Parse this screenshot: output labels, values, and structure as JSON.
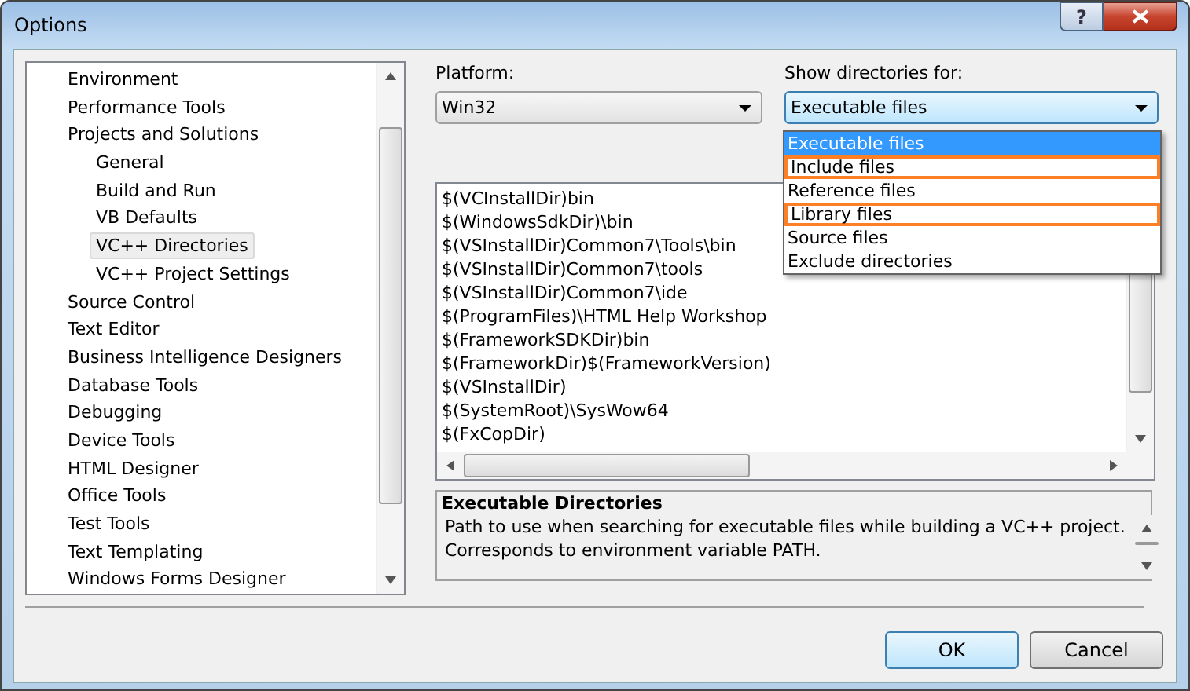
{
  "window": {
    "title": "Options",
    "help_button": "?"
  },
  "tree": {
    "items": [
      {
        "label": "Environment",
        "selected": false
      },
      {
        "label": "Performance Tools",
        "selected": false
      },
      {
        "label": "Projects and Solutions",
        "selected": false,
        "children": [
          {
            "label": "General",
            "selected": false
          },
          {
            "label": "Build and Run",
            "selected": false
          },
          {
            "label": "VB Defaults",
            "selected": false
          },
          {
            "label": "VC++ Directories",
            "selected": true
          },
          {
            "label": "VC++ Project Settings",
            "selected": false
          }
        ]
      },
      {
        "label": "Source Control",
        "selected": false
      },
      {
        "label": "Text Editor",
        "selected": false
      },
      {
        "label": "Business Intelligence Designers",
        "selected": false
      },
      {
        "label": "Database Tools",
        "selected": false
      },
      {
        "label": "Debugging",
        "selected": false
      },
      {
        "label": "Device Tools",
        "selected": false
      },
      {
        "label": "HTML Designer",
        "selected": false
      },
      {
        "label": "Office Tools",
        "selected": false
      },
      {
        "label": "Test Tools",
        "selected": false
      },
      {
        "label": "Text Templating",
        "selected": false
      },
      {
        "label": "Windows Forms Designer",
        "selected": false
      }
    ]
  },
  "platform": {
    "label": "Platform:",
    "value": "Win32"
  },
  "show_directories": {
    "label": "Show directories for:",
    "value": "Executable files",
    "expanded": true,
    "options": [
      {
        "label": "Executable files",
        "selected": true,
        "highlighted": false
      },
      {
        "label": "Include files",
        "selected": false,
        "highlighted": true
      },
      {
        "label": "Reference files",
        "selected": false,
        "highlighted": false
      },
      {
        "label": "Library files",
        "selected": false,
        "highlighted": true
      },
      {
        "label": "Source files",
        "selected": false,
        "highlighted": false
      },
      {
        "label": "Exclude directories",
        "selected": false,
        "highlighted": false
      }
    ]
  },
  "directories": [
    "$(VCInstallDir)bin",
    "$(WindowsSdkDir)\\bin",
    "$(VSInstallDir)Common7\\Tools\\bin",
    "$(VSInstallDir)Common7\\tools",
    "$(VSInstallDir)Common7\\ide",
    "$(ProgramFiles)\\HTML Help Workshop",
    "$(FrameworkSDKDir)bin",
    "$(FrameworkDir)$(FrameworkVersion)",
    "$(VSInstallDir)",
    "$(SystemRoot)\\SysWow64",
    "$(FxCopDir)"
  ],
  "description": {
    "title": "Executable Directories",
    "lines": [
      "Path to use when searching for executable files while building a VC++ project.",
      "Corresponds to environment variable PATH."
    ]
  },
  "buttons": [
    {
      "label": "OK",
      "default": true
    },
    {
      "label": "Cancel",
      "default": false
    }
  ]
}
